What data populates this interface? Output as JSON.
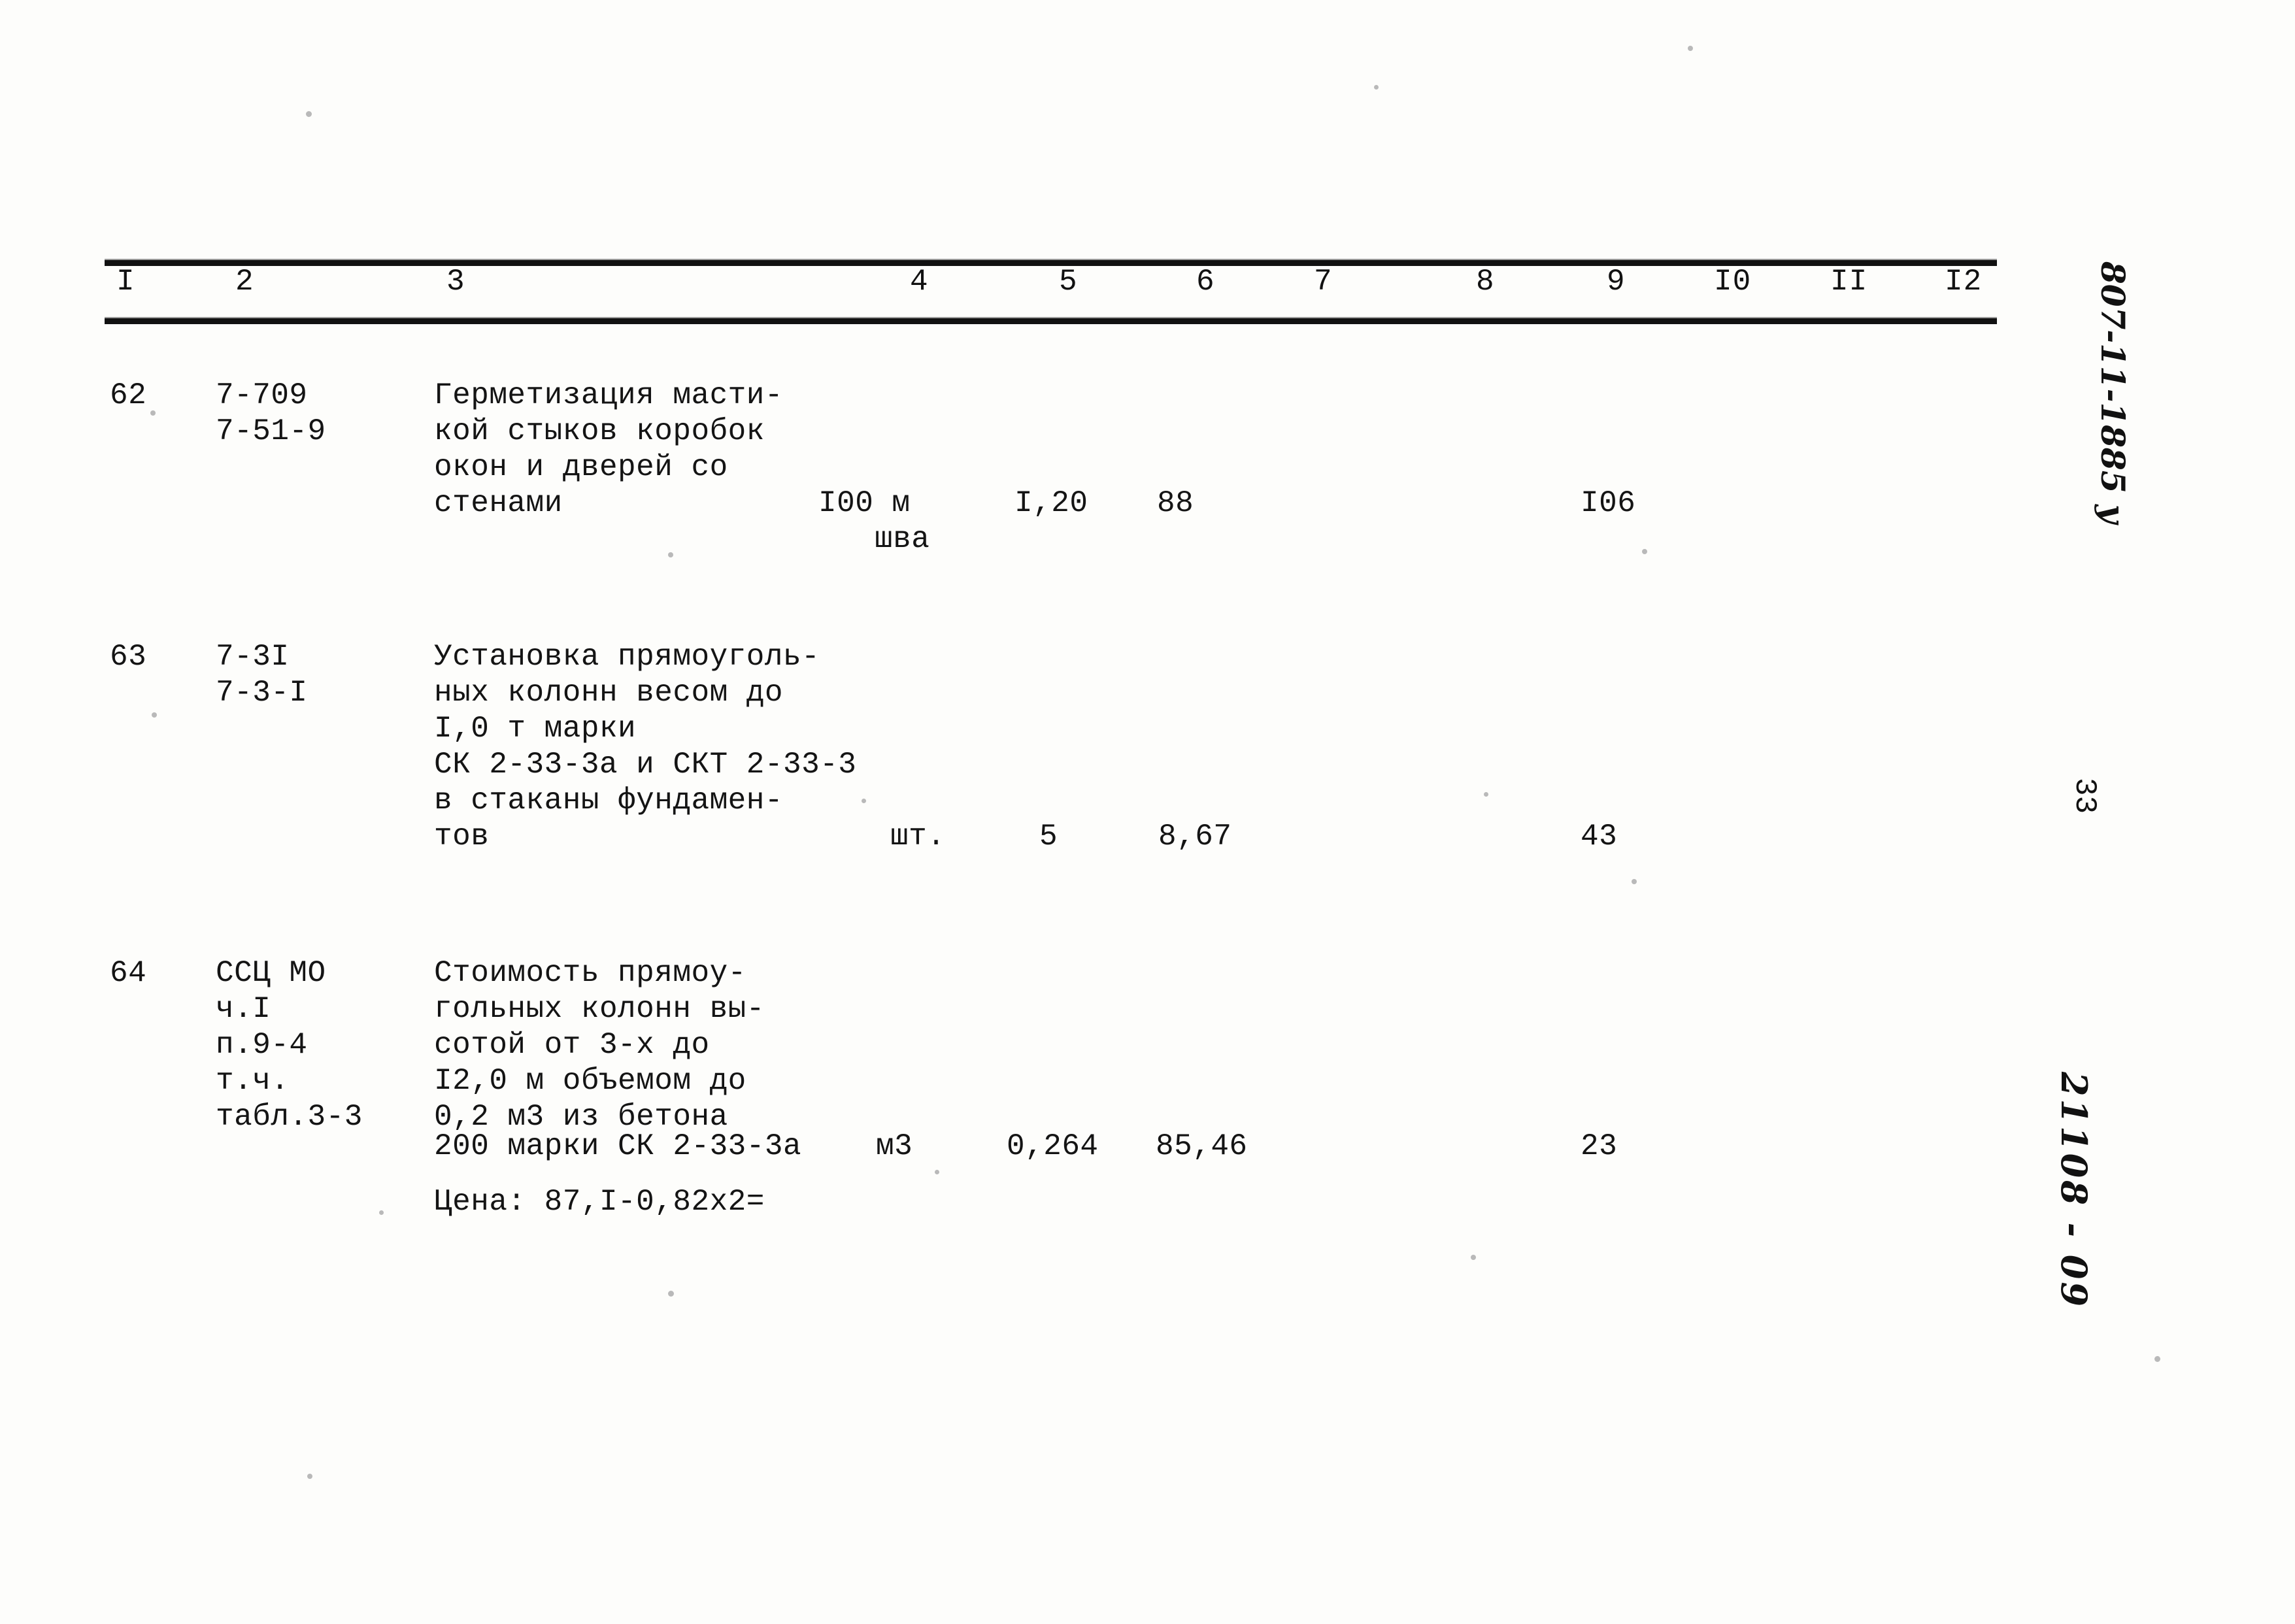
{
  "document": {
    "type": "construction-estimate-table",
    "page_number": "33",
    "archive_code_top": "807-11-1885 у",
    "archive_code_bottom": "21108 - 09"
  },
  "table": {
    "column_headers": [
      "I",
      "2",
      "3",
      "4",
      "5",
      "6",
      "7",
      "8",
      "9",
      "I0",
      "II",
      "I2"
    ],
    "rows": [
      {
        "no": "62",
        "codes": [
          "7-709",
          "7-51-9"
        ],
        "description_lines": [
          "Герметизация масти-",
          "кой стыков коробок",
          "окон и дверей со",
          "стенами"
        ],
        "unit_line1": "I00 м",
        "unit_line2": "шва",
        "col5": "I,20",
        "col6": "88",
        "col9": "I06"
      },
      {
        "no": "63",
        "codes": [
          "7-3I",
          "7-3-I"
        ],
        "description_lines": [
          "Установка прямоуголь-",
          "ных колонн весом до",
          "I,0 т марки",
          "СК 2-33-3а и СКТ 2-33-3",
          "в стаканы фундамен-",
          "тов"
        ],
        "unit_line1": "шт.",
        "unit_line2": "",
        "col5": "5",
        "col6": "8,67",
        "col9": "43"
      },
      {
        "no": "64",
        "codes": [
          "ССЦ МО",
          "ч.I",
          "п.9-4",
          "т.ч.",
          "табл.3-3"
        ],
        "description_lines": [
          "Стоимость прямоу-",
          "гольных колонн вы-",
          "сотой от 3-х до",
          "I2,0 м объемом до",
          "0,2 м3 из бетона",
          "200 марки СК 2-33-3а"
        ],
        "note": "Цена: 87,I-0,82х2=",
        "unit_line1": "м3",
        "unit_line2": "",
        "col5": "0,264",
        "col6": "85,46",
        "col9": "23"
      }
    ]
  }
}
